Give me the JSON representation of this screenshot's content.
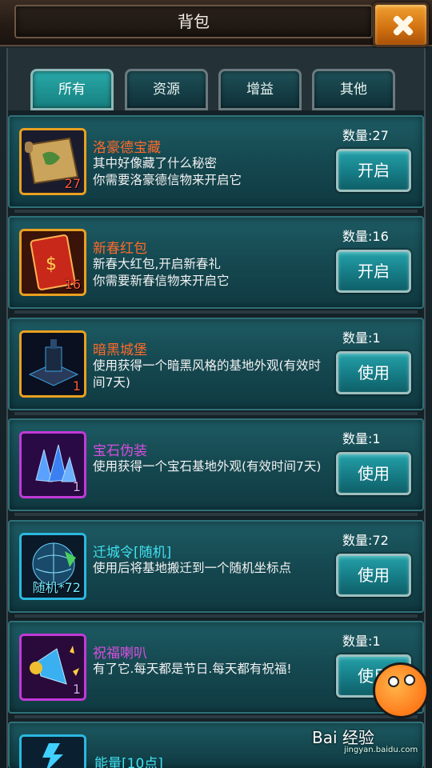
{
  "header": {
    "title": "背包"
  },
  "tabs": [
    {
      "label": "所有",
      "active": true
    },
    {
      "label": "资源",
      "active": false
    },
    {
      "label": "增益",
      "active": false
    },
    {
      "label": "其他",
      "active": false
    }
  ],
  "items": [
    {
      "name": "洛豪德宝藏",
      "desc": "其中好像藏了什么秘密\n你需要洛豪德信物来开启它",
      "qty": "数量:27",
      "count": "27",
      "button": "开启",
      "icon": "treasure-map-icon",
      "color": "orange"
    },
    {
      "name": "新春红包",
      "desc": "新春大红包,开启新春礼\n你需要新春信物来开启它",
      "qty": "数量:16",
      "count": "16",
      "button": "开启",
      "icon": "red-envelope-icon",
      "color": "orange"
    },
    {
      "name": "暗黑城堡",
      "desc": "使用获得一个暗黑风格的基地外观(有效时间7天)",
      "qty": "数量:1",
      "count": "1",
      "button": "使用",
      "icon": "dark-castle-icon",
      "color": "orange"
    },
    {
      "name": "宝石伪装",
      "desc": "使用获得一个宝石基地外观(有效时间7天)",
      "qty": "数量:1",
      "count": "1",
      "button": "使用",
      "icon": "gem-crystal-icon",
      "color": "purple"
    },
    {
      "name": "迁城令[随机]",
      "desc": "使用后将基地搬迁到一个随机坐标点",
      "qty": "数量:72",
      "count": "随机*72",
      "button": "使用",
      "icon": "globe-relocate-icon",
      "color": "cyan"
    },
    {
      "name": "祝福喇叭",
      "desc": "有了它.每天都是节日.每天都有祝福!",
      "qty": "数量:1",
      "count": "1",
      "button": "使用",
      "icon": "blessing-horn-icon",
      "color": "purple"
    }
  ],
  "peek_item": {
    "name": "能量[10点]"
  },
  "watermark": {
    "brand": "Bai 经验",
    "url": "jingyan.baidu.com"
  }
}
